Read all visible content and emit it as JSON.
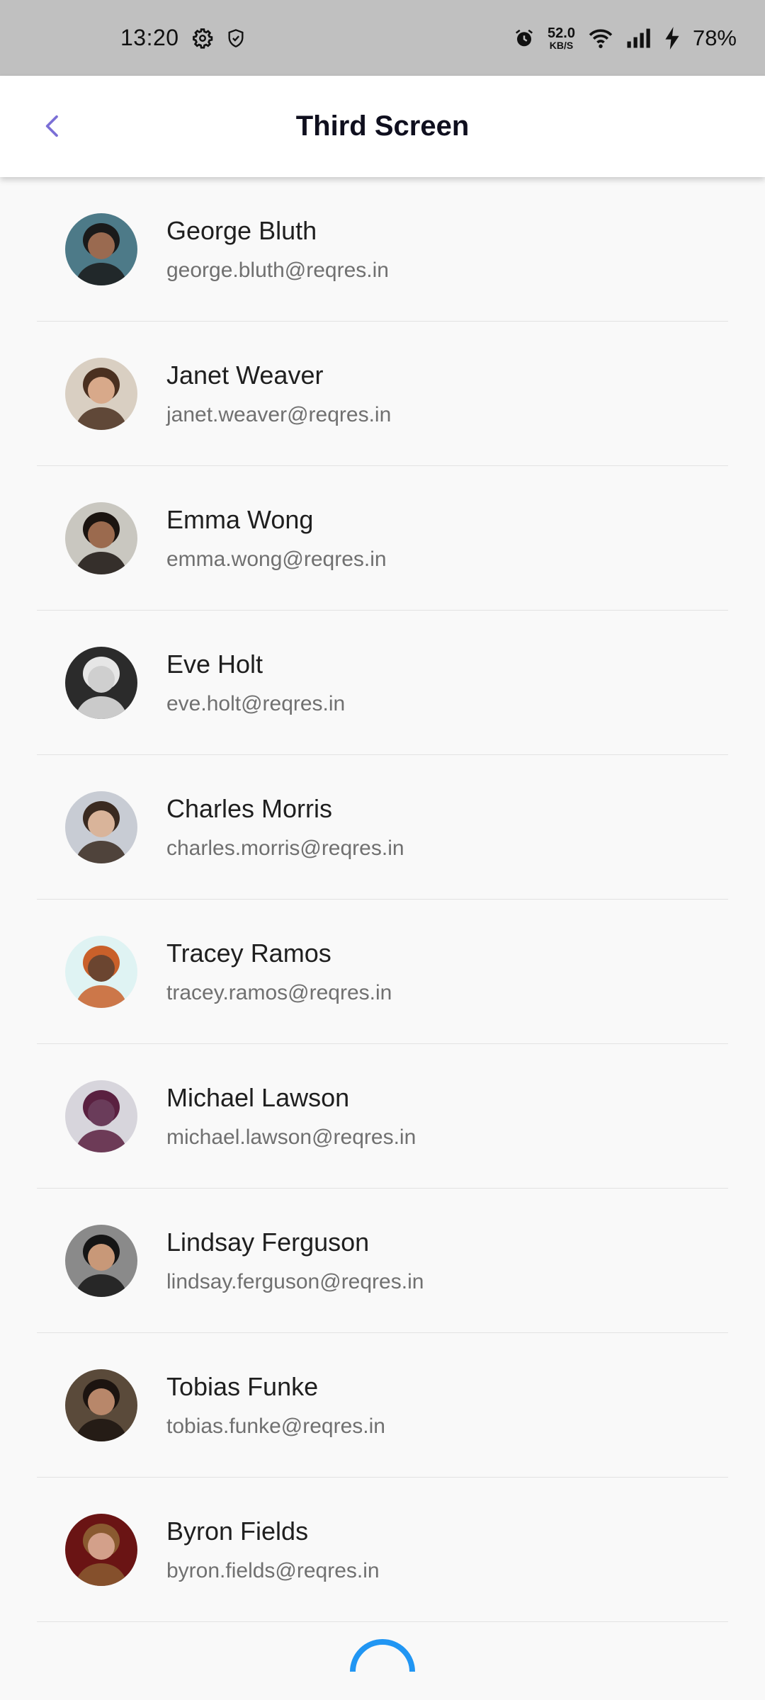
{
  "status_bar": {
    "time": "13:20",
    "net_speed_value": "52.0",
    "net_speed_unit": "KB/S",
    "battery": "78%",
    "icons": [
      "settings-icon",
      "shield-icon",
      "alarm-icon",
      "wifi-icon",
      "signal-icon",
      "charging-icon"
    ]
  },
  "app_bar": {
    "title": "Third Screen",
    "back_icon": "chevron-left-icon",
    "accent_color": "#7b6fd6"
  },
  "users": [
    {
      "name": "George Bluth",
      "email": "george.bluth@reqres.in",
      "avatar_bg": "#4d7a88",
      "avatar_skin": "#9a6a50",
      "avatar_hair": "#1a1a1a"
    },
    {
      "name": "Janet Weaver",
      "email": "janet.weaver@reqres.in",
      "avatar_bg": "#d9cfc2",
      "avatar_skin": "#d8a98a",
      "avatar_hair": "#4a3020"
    },
    {
      "name": "Emma Wong",
      "email": "emma.wong@reqres.in",
      "avatar_bg": "#c9c7c0",
      "avatar_skin": "#9b6a4e",
      "avatar_hair": "#1b1410"
    },
    {
      "name": "Eve Holt",
      "email": "eve.holt@reqres.in",
      "avatar_bg": "#2b2b2b",
      "avatar_skin": "#cfcfcf",
      "avatar_hair": "#e6e6e6"
    },
    {
      "name": "Charles Morris",
      "email": "charles.morris@reqres.in",
      "avatar_bg": "#c8ccd4",
      "avatar_skin": "#d9b49a",
      "avatar_hair": "#3a2a20"
    },
    {
      "name": "Tracey Ramos",
      "email": "tracey.ramos@reqres.in",
      "avatar_bg": "#dff3f3",
      "avatar_skin": "#6b4530",
      "avatar_hair": "#c9602a"
    },
    {
      "name": "Michael Lawson",
      "email": "michael.lawson@reqres.in",
      "avatar_bg": "#d7d5dc",
      "avatar_skin": "#6a3c5a",
      "avatar_hair": "#5a2040"
    },
    {
      "name": "Lindsay Ferguson",
      "email": "lindsay.ferguson@reqres.in",
      "avatar_bg": "#8a8a8a",
      "avatar_skin": "#c89878",
      "avatar_hair": "#151515"
    },
    {
      "name": "Tobias Funke",
      "email": "tobias.funke@reqres.in",
      "avatar_bg": "#5a4a3a",
      "avatar_skin": "#b8876a",
      "avatar_hair": "#1c1410"
    },
    {
      "name": "Byron Fields",
      "email": "byron.fields@reqres.in",
      "avatar_bg": "#6a1414",
      "avatar_skin": "#d3a08a",
      "avatar_hair": "#8a5a30"
    }
  ],
  "loading_spinner_color": "#2196f3"
}
